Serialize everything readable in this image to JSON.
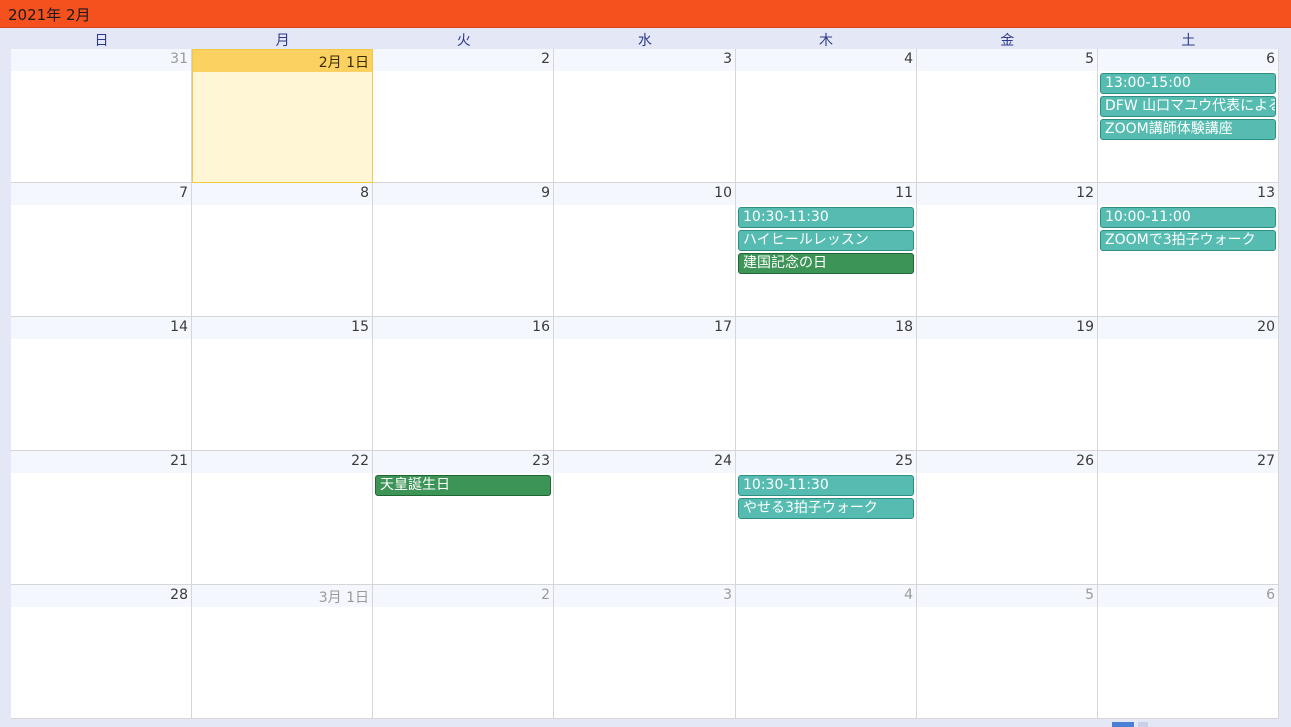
{
  "header": {
    "title": "2021年 2月"
  },
  "weekdays": [
    "日",
    "月",
    "火",
    "水",
    "木",
    "金",
    "土"
  ],
  "weeks": [
    [
      {
        "day": "31",
        "other": true
      },
      {
        "day": "2月 1日",
        "today": true
      },
      {
        "day": "2"
      },
      {
        "day": "3"
      },
      {
        "day": "4"
      },
      {
        "day": "5"
      },
      {
        "day": "6",
        "events": [
          {
            "text": "13:00-15:00",
            "kind": "teal"
          },
          {
            "text": "DFW 山口マユウ代表による",
            "kind": "teal"
          },
          {
            "text": "ZOOM講師体験講座",
            "kind": "teal"
          }
        ]
      }
    ],
    [
      {
        "day": "7"
      },
      {
        "day": "8"
      },
      {
        "day": "9"
      },
      {
        "day": "10"
      },
      {
        "day": "11",
        "events": [
          {
            "text": "10:30-11:30",
            "kind": "teal"
          },
          {
            "text": "ハイヒールレッスン",
            "kind": "teal"
          },
          {
            "text": "建国記念の日",
            "kind": "green"
          }
        ]
      },
      {
        "day": "12"
      },
      {
        "day": "13",
        "events": [
          {
            "text": "10:00-11:00",
            "kind": "teal"
          },
          {
            "text": "ZOOMで3拍子ウォーク",
            "kind": "teal"
          }
        ]
      }
    ],
    [
      {
        "day": "14"
      },
      {
        "day": "15"
      },
      {
        "day": "16"
      },
      {
        "day": "17"
      },
      {
        "day": "18"
      },
      {
        "day": "19"
      },
      {
        "day": "20"
      }
    ],
    [
      {
        "day": "21"
      },
      {
        "day": "22"
      },
      {
        "day": "23",
        "events": [
          {
            "text": "天皇誕生日",
            "kind": "green"
          }
        ]
      },
      {
        "day": "24"
      },
      {
        "day": "25",
        "events": [
          {
            "text": "10:30-11:30",
            "kind": "teal"
          },
          {
            "text": "やせる3拍子ウォーク",
            "kind": "teal"
          }
        ]
      },
      {
        "day": "26"
      },
      {
        "day": "27"
      }
    ],
    [
      {
        "day": "28"
      },
      {
        "day": "3月 1日",
        "other": true
      },
      {
        "day": "2",
        "other": true
      },
      {
        "day": "3",
        "other": true
      },
      {
        "day": "4",
        "other": true
      },
      {
        "day": "5",
        "other": true
      },
      {
        "day": "6",
        "other": true
      }
    ]
  ],
  "colors": {
    "header_bg": "#f4511e",
    "today_bg": "#fff6d6",
    "today_bar": "#fbd262",
    "event_teal": "#56bcb1",
    "event_green": "#3d9457",
    "weekday_text": "#2d3a8c"
  }
}
